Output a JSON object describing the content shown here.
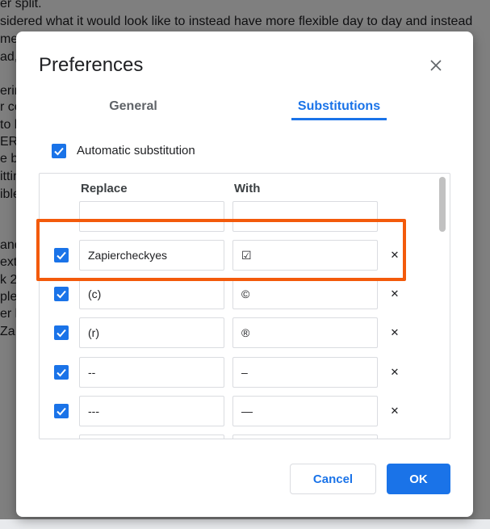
{
  "background_doc": {
    "lines": [
      "er split.",
      "sidered what it would look like to instead have more flexible day to day and instead",
      "me",
      "ad,",
      "erin",
      "r co",
      "to h",
      "ERI",
      "e be",
      "ittin",
      "ible",
      "and",
      "ext w",
      "k 2",
      "plet",
      "er l",
      "Za"
    ]
  },
  "dialog": {
    "title": "Preferences",
    "close_icon": "close-icon",
    "tabs": [
      {
        "label": "General",
        "active": false
      },
      {
        "label": "Substitutions",
        "active": true
      }
    ],
    "auto_substitution": {
      "label": "Automatic substitution",
      "checked": true
    },
    "table": {
      "headers": {
        "replace": "Replace",
        "with": "With"
      },
      "new_row": {
        "replace": "",
        "with": ""
      },
      "rows": [
        {
          "checked": true,
          "replace": "Zapiercheckyes",
          "with": "☑",
          "highlighted": true
        },
        {
          "checked": true,
          "replace": "(c)",
          "with": "©"
        },
        {
          "checked": true,
          "replace": "(r)",
          "with": "®"
        },
        {
          "checked": true,
          "replace": "--",
          "with": "–"
        },
        {
          "checked": true,
          "replace": "---",
          "with": "—"
        }
      ],
      "delete_icon": "delete-x-icon"
    },
    "buttons": {
      "cancel": "Cancel",
      "ok": "OK"
    },
    "colors": {
      "accent": "#1a73e8",
      "highlight": "#f35a0b"
    }
  }
}
